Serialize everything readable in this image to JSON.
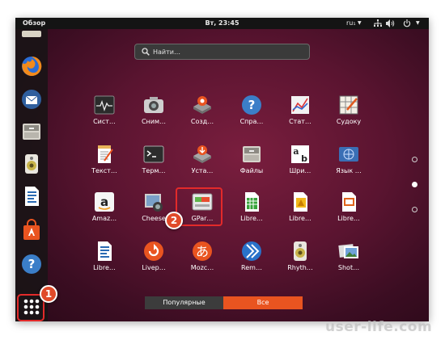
{
  "topbar": {
    "overview": "Обзор",
    "clock": "Вт, 23:45",
    "lang": "ru₁"
  },
  "search": {
    "placeholder": "Найти…"
  },
  "apps": [
    {
      "label": "Сист…",
      "icon": "system-monitor-icon"
    },
    {
      "label": "Сним…",
      "icon": "screenshot-icon"
    },
    {
      "label": "Созд…",
      "icon": "startup-disk-creator-icon"
    },
    {
      "label": "Спра…",
      "icon": "help-icon"
    },
    {
      "label": "Стат…",
      "icon": "statistics-icon"
    },
    {
      "label": "Судоку",
      "icon": "sudoku-icon"
    },
    {
      "label": "Текст…",
      "icon": "text-editor-icon"
    },
    {
      "label": "Терм…",
      "icon": "terminal-icon"
    },
    {
      "label": "Уста…",
      "icon": "software-installer-icon"
    },
    {
      "label": "Файлы",
      "icon": "files-icon"
    },
    {
      "label": "Шри…",
      "icon": "fonts-icon"
    },
    {
      "label": "Язык …",
      "icon": "language-support-icon"
    },
    {
      "label": "Amaz…",
      "icon": "amazon-icon"
    },
    {
      "label": "Cheese",
      "icon": "cheese-icon"
    },
    {
      "label": "GPar…",
      "icon": "gparted-icon"
    },
    {
      "label": "Libre…",
      "icon": "libreoffice-calc-icon"
    },
    {
      "label": "Libre…",
      "icon": "libreoffice-draw-icon"
    },
    {
      "label": "Libre…",
      "icon": "libreoffice-impress-icon"
    },
    {
      "label": "Libre…",
      "icon": "libreoffice-writer-icon"
    },
    {
      "label": "Livep…",
      "icon": "livepatch-icon"
    },
    {
      "label": "Mozc…",
      "icon": "mozc-icon"
    },
    {
      "label": "Rem…",
      "icon": "remmina-icon"
    },
    {
      "label": "Rhyth…",
      "icon": "rhythmbox-icon"
    },
    {
      "label": "Shot…",
      "icon": "shotwell-icon"
    }
  ],
  "tabs": {
    "popular": "Популярные",
    "all": "Все"
  },
  "annotations": {
    "badge1": "1",
    "badge2": "2"
  },
  "watermark": "user-life.com",
  "colors": {
    "accent": "#e95420",
    "highlight": "#e32a2a",
    "topbar": "#141414"
  }
}
